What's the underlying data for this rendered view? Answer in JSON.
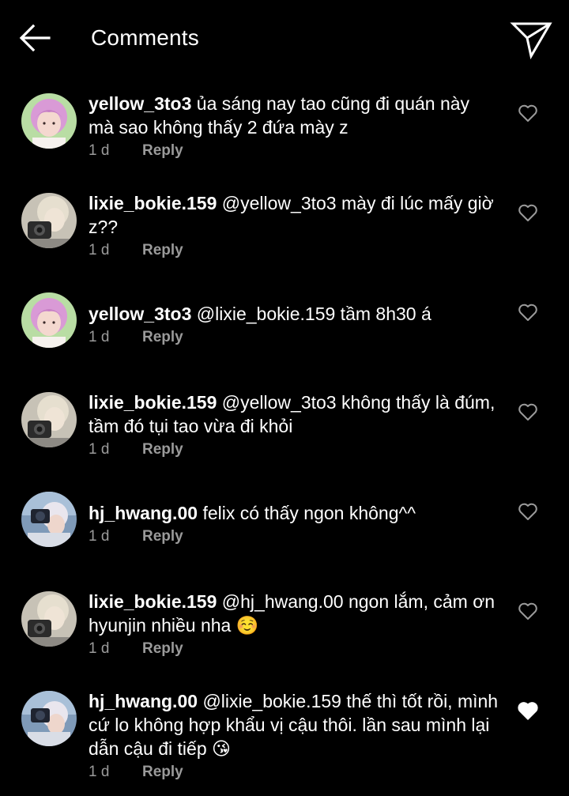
{
  "header": {
    "title": "Comments",
    "back_icon": "arrow-left-icon",
    "send_icon": "paper-plane-icon"
  },
  "colors": {
    "background": "#000000",
    "text": "#ffffff",
    "muted": "#9a9a9a",
    "liked_heart": "#ffffff"
  },
  "comments": [
    {
      "username": "yellow_3to3",
      "text": "ủa sáng nay tao cũng đi quán này mà sao không thấy 2 đứa mày z",
      "time": "1 d",
      "reply_label": "Reply",
      "liked": false,
      "avatar": "pink-hair-avatar"
    },
    {
      "username": "lixie_bokie.159",
      "text": "@yellow_3to3 mày đi lúc mấy giờ z??",
      "time": "1 d",
      "reply_label": "Reply",
      "liked": false,
      "avatar": "camera-avatar"
    },
    {
      "username": "yellow_3to3",
      "text": "@lixie_bokie.159 tầm 8h30 á",
      "time": "1 d",
      "reply_label": "Reply",
      "liked": false,
      "avatar": "pink-hair-avatar"
    },
    {
      "username": "lixie_bokie.159",
      "text": "@yellow_3to3 không thấy là đúm, tầm đó tụi tao vừa đi khỏi",
      "time": "1 d",
      "reply_label": "Reply",
      "liked": false,
      "avatar": "camera-avatar"
    },
    {
      "username": "hj_hwang.00",
      "text": "felix có thấy ngon không^^",
      "time": "1 d",
      "reply_label": "Reply",
      "liked": false,
      "avatar": "photographer-avatar"
    },
    {
      "username": "lixie_bokie.159",
      "text": "@hj_hwang.00 ngon lắm, cảm ơn hyunjin nhiều nha ☺️",
      "time": "1 d",
      "reply_label": "Reply",
      "liked": false,
      "avatar": "camera-avatar"
    },
    {
      "username": "hj_hwang.00",
      "text": "@lixie_bokie.159 thế thì tốt rồi, mình cứ lo không hợp khẩu vị cậu thôi. lần sau mình lại dẫn cậu đi tiếp 😘",
      "time": "1 d",
      "reply_label": "Reply",
      "liked": true,
      "avatar": "photographer-avatar"
    }
  ]
}
